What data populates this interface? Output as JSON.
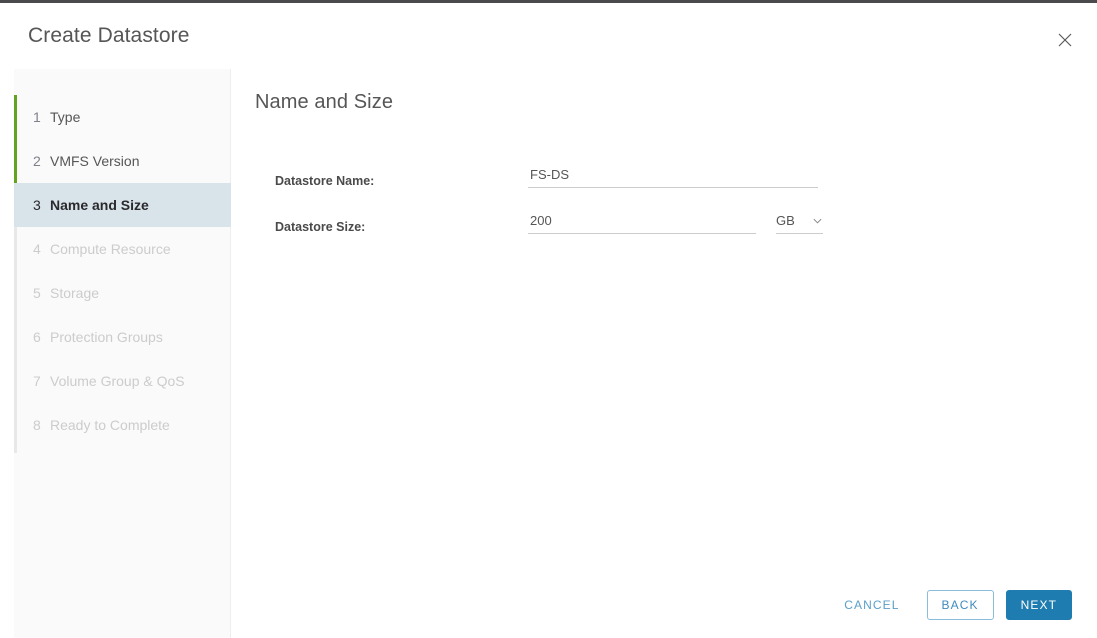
{
  "window": {
    "title": "Create Datastore",
    "close_icon": "close-icon"
  },
  "sidebar": {
    "steps": [
      {
        "num": "1",
        "label": "Type",
        "state": "completed"
      },
      {
        "num": "2",
        "label": "VMFS Version",
        "state": "completed"
      },
      {
        "num": "3",
        "label": "Name and Size",
        "state": "active"
      },
      {
        "num": "4",
        "label": "Compute Resource",
        "state": "disabled"
      },
      {
        "num": "5",
        "label": "Storage",
        "state": "disabled"
      },
      {
        "num": "6",
        "label": "Protection Groups",
        "state": "disabled"
      },
      {
        "num": "7",
        "label": "Volume Group & QoS",
        "state": "disabled"
      },
      {
        "num": "8",
        "label": "Ready to Complete",
        "state": "disabled"
      }
    ],
    "progress_color": "#62a420",
    "active_color": "#d9e4ea"
  },
  "main": {
    "heading": "Name and Size",
    "fields": {
      "datastore_name": {
        "label": "Datastore Name:",
        "value": "FS-DS",
        "placeholder": ""
      },
      "datastore_size": {
        "label": "Datastore Size:",
        "value": "200",
        "placeholder": "",
        "unit": "GB",
        "unit_icon": "chevron-down-icon"
      }
    }
  },
  "footer": {
    "cancel_label": "Cancel",
    "back_label": "Back",
    "next_label": "Next",
    "primary_color": "#1f7cb0"
  }
}
